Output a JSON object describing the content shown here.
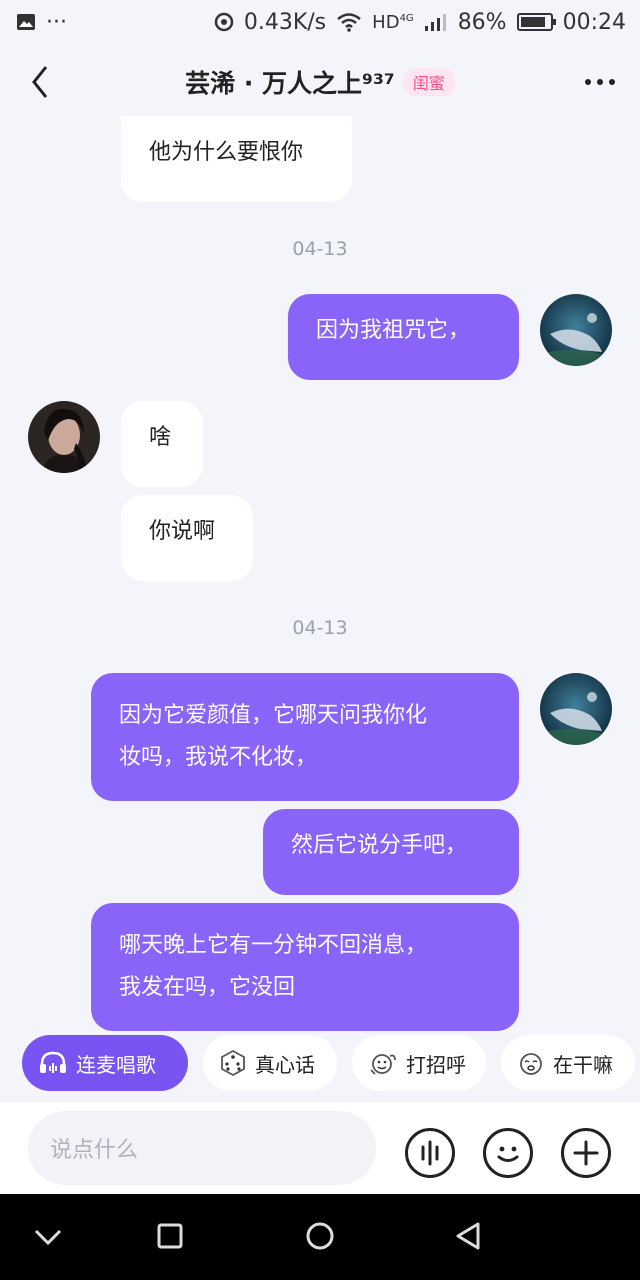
{
  "status_bar": {
    "speed": "0.43K/s",
    "network": "HD",
    "network_gen": "4G",
    "battery": "86%",
    "battery_level": 0.86,
    "time": "00:24"
  },
  "header": {
    "title": "芸浠 · 万人之上⁹³⁷",
    "badge": "闺蜜",
    "badge_color": "#f0508a"
  },
  "chat": {
    "messages": [
      {
        "side": "in",
        "text": "他为什么要恨你"
      },
      {
        "type": "divider",
        "text": "04-13"
      },
      {
        "side": "out",
        "text": "因为我祖咒它，"
      },
      {
        "side": "in",
        "text": "啥"
      },
      {
        "side": "in",
        "text": "你说啊"
      },
      {
        "type": "divider",
        "text": "04-13"
      },
      {
        "side": "out",
        "text": "因为它爱颜值，它哪天问我你化\n妆吗，我说不化妆，"
      },
      {
        "side": "out",
        "text": "然后它说分手吧，"
      },
      {
        "side": "out",
        "text": "哪天晚上它有一分钟不回消息，\n我发在吗，它没回"
      }
    ]
  },
  "quick_actions": [
    {
      "label": "连麦唱歌",
      "icon": "headphones-icon"
    },
    {
      "label": "真心话",
      "icon": "dice-icon"
    },
    {
      "label": "打招呼",
      "icon": "wave-hello-icon"
    },
    {
      "label": "在干嘛",
      "icon": "sleepy-face-icon"
    }
  ],
  "input": {
    "placeholder": "说点什么"
  },
  "colors": {
    "accent": "#8a63f8",
    "chip_primary": "#7a54f2",
    "background": "#f4f5fb"
  }
}
